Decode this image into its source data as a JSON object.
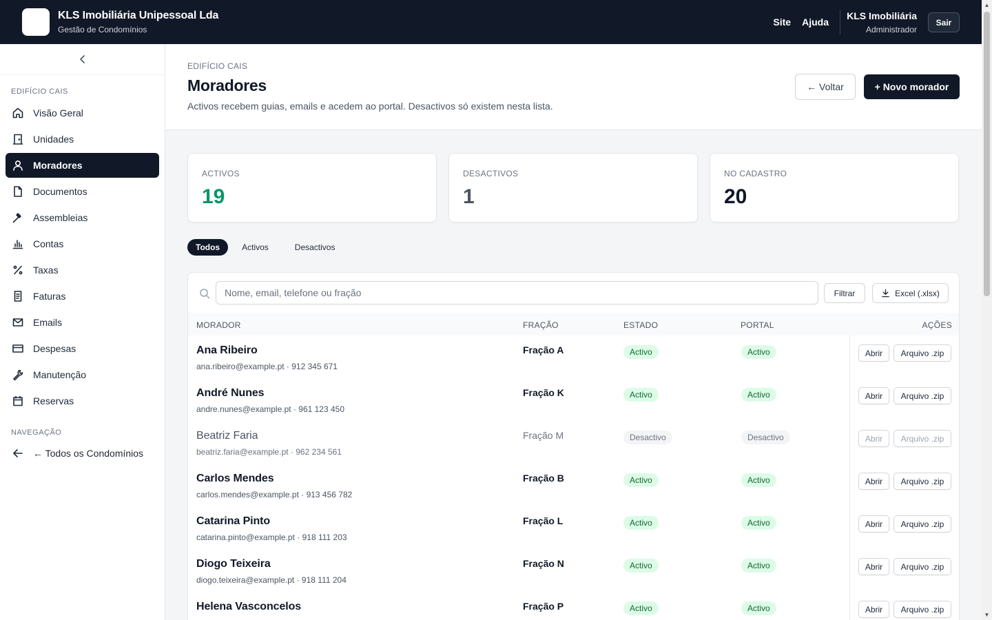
{
  "topbar": {
    "company": "KLS Imobiliária Unipessoal Lda",
    "subtitle": "Gestão de Condomínios",
    "links": [
      "Site",
      "Ajuda"
    ],
    "user_name": "KLS Imobiliária",
    "user_role": "Administrador",
    "logout_label": "Sair"
  },
  "sidebar": {
    "section_building": "EDIFÍCIO CAIS",
    "items": [
      {
        "label": "Visão Geral",
        "icon": "home-icon"
      },
      {
        "label": "Unidades",
        "icon": "door-icon"
      },
      {
        "label": "Moradores",
        "icon": "user-icon",
        "active": true
      },
      {
        "label": "Documentos",
        "icon": "file-icon"
      },
      {
        "label": "Assembleias",
        "icon": "gavel-icon"
      },
      {
        "label": "Contas",
        "icon": "bar-chart-icon"
      },
      {
        "label": "Taxas",
        "icon": "percent-icon"
      },
      {
        "label": "Faturas",
        "icon": "receipt-icon"
      },
      {
        "label": "Emails",
        "icon": "mail-icon"
      },
      {
        "label": "Despesas",
        "icon": "credit-card-icon"
      },
      {
        "label": "Manutenção",
        "icon": "wrench-icon"
      },
      {
        "label": "Reservas",
        "icon": "calendar-icon"
      }
    ],
    "section_nav": "NAVEGAÇÃO",
    "back_all": "← Todos os Condomínios"
  },
  "header": {
    "breadcrumb": "EDIFÍCIO CAIS",
    "title": "Moradores",
    "description": "Activos recebem guias, emails e acedem ao portal. Desactivos só existem nesta lista.",
    "back_label": "← Voltar",
    "new_label": "+ Novo morador"
  },
  "stats": [
    {
      "label": "ACTIVOS",
      "value": "19",
      "color": "#059669"
    },
    {
      "label": "DESACTIVOS",
      "value": "1",
      "color": "#4b5563"
    },
    {
      "label": "NO CADASTRO",
      "value": "20",
      "color": "#111827"
    }
  ],
  "tabs": [
    "Todos",
    "Activos",
    "Desactivos"
  ],
  "toolbar": {
    "search_placeholder": "Nome, email, telefone ou fração",
    "filter_label": "Filtrar",
    "excel_label": "Excel (.xlsx)"
  },
  "table": {
    "columns": [
      "MORADOR",
      "FRAÇÃO",
      "ESTADO",
      "PORTAL",
      "AÇÕES"
    ],
    "open_label": "Abrir",
    "archive_label": "Arquivo .zip",
    "rows": [
      {
        "name": "Ana Ribeiro",
        "contact": "ana.ribeiro@example.pt · 912 345 671",
        "fracao": "Fração A",
        "estado": "Activo",
        "portal": "Activo",
        "active": true
      },
      {
        "name": "André Nunes",
        "contact": "andre.nunes@example.pt · 961 123 450",
        "fracao": "Fração K",
        "estado": "Activo",
        "portal": "Activo",
        "active": true
      },
      {
        "name": "Beatriz Faria",
        "contact": "beatriz.faria@example.pt · 962 234 561",
        "fracao": "Fração M",
        "estado": "Desactivo",
        "portal": "Desactivo",
        "active": false
      },
      {
        "name": "Carlos Mendes",
        "contact": "carlos.mendes@example.pt · 913 456 782",
        "fracao": "Fração B",
        "estado": "Activo",
        "portal": "Activo",
        "active": true
      },
      {
        "name": "Catarina Pinto",
        "contact": "catarina.pinto@example.pt · 918 111 203",
        "fracao": "Fração L",
        "estado": "Activo",
        "portal": "Activo",
        "active": true
      },
      {
        "name": "Diogo Teixeira",
        "contact": "diogo.teixeira@example.pt · 918 111 204",
        "fracao": "Fração N",
        "estado": "Activo",
        "portal": "Activo",
        "active": true
      },
      {
        "name": "Helena Vasconcelos",
        "contact": "",
        "fracao": "Fração P",
        "estado": "Activo",
        "portal": "Activo",
        "active": true
      }
    ]
  }
}
